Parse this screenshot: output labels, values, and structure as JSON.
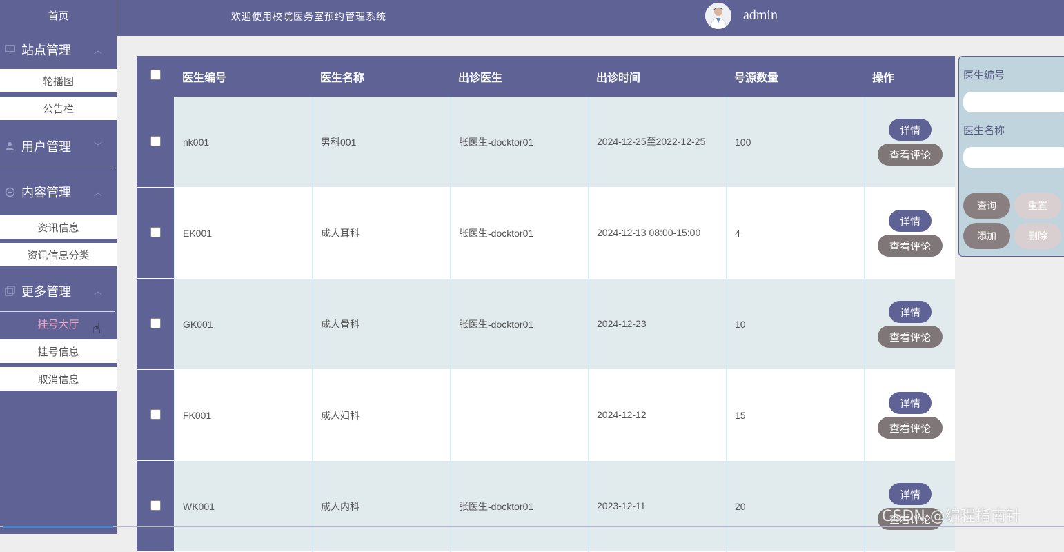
{
  "sidebar": {
    "home": "首页",
    "groups": {
      "site": {
        "label": "站点管理",
        "items": [
          "轮播图",
          "公告栏"
        ]
      },
      "user": {
        "label": "用户管理"
      },
      "content": {
        "label": "内容管理",
        "items": [
          "资讯信息",
          "资讯信息分类"
        ]
      },
      "more": {
        "label": "更多管理",
        "items": [
          "挂号大厅",
          "挂号信息",
          "取消信息"
        ]
      }
    },
    "active_item": "挂号大厅"
  },
  "header": {
    "welcome": "欢迎使用校院医务室预约管理系统",
    "username": "admin"
  },
  "table": {
    "columns": [
      "医生编号",
      "医生名称",
      "出诊医生",
      "出诊时间",
      "号源数量",
      "操作"
    ],
    "rows": [
      {
        "id": "nk001",
        "name": "男科001",
        "doctor": "张医生-docktor01",
        "time": "2024-12-25至2022-12-25",
        "count": "100"
      },
      {
        "id": "EK001",
        "name": "成人耳科",
        "doctor": "张医生-docktor01",
        "time": "2024-12-13 08:00-15:00",
        "count": "4"
      },
      {
        "id": "GK001",
        "name": "成人骨科",
        "doctor": "张医生-docktor01",
        "time": "2024-12-23",
        "count": "10"
      },
      {
        "id": "FK001",
        "name": "成人妇科",
        "doctor": "",
        "time": "2024-12-12",
        "count": "15"
      },
      {
        "id": "WK001",
        "name": "成人内科",
        "doctor": "张医生-docktor01",
        "time": "2023-12-11",
        "count": "20"
      }
    ],
    "detail_label": "详情",
    "review_label": "查看评论"
  },
  "search": {
    "label_id": "医生编号",
    "label_name": "医生名称",
    "query": "查询",
    "reset": "重置",
    "add": "添加",
    "delete": "删除"
  },
  "watermark": "CSDN @编程指南针",
  "colors": {
    "primary": "#5f6295",
    "row_alt": "#e1eaec",
    "review_btn": "#7f7677",
    "active_text": "#f2a7c5",
    "panel": "#bfd4dd"
  }
}
